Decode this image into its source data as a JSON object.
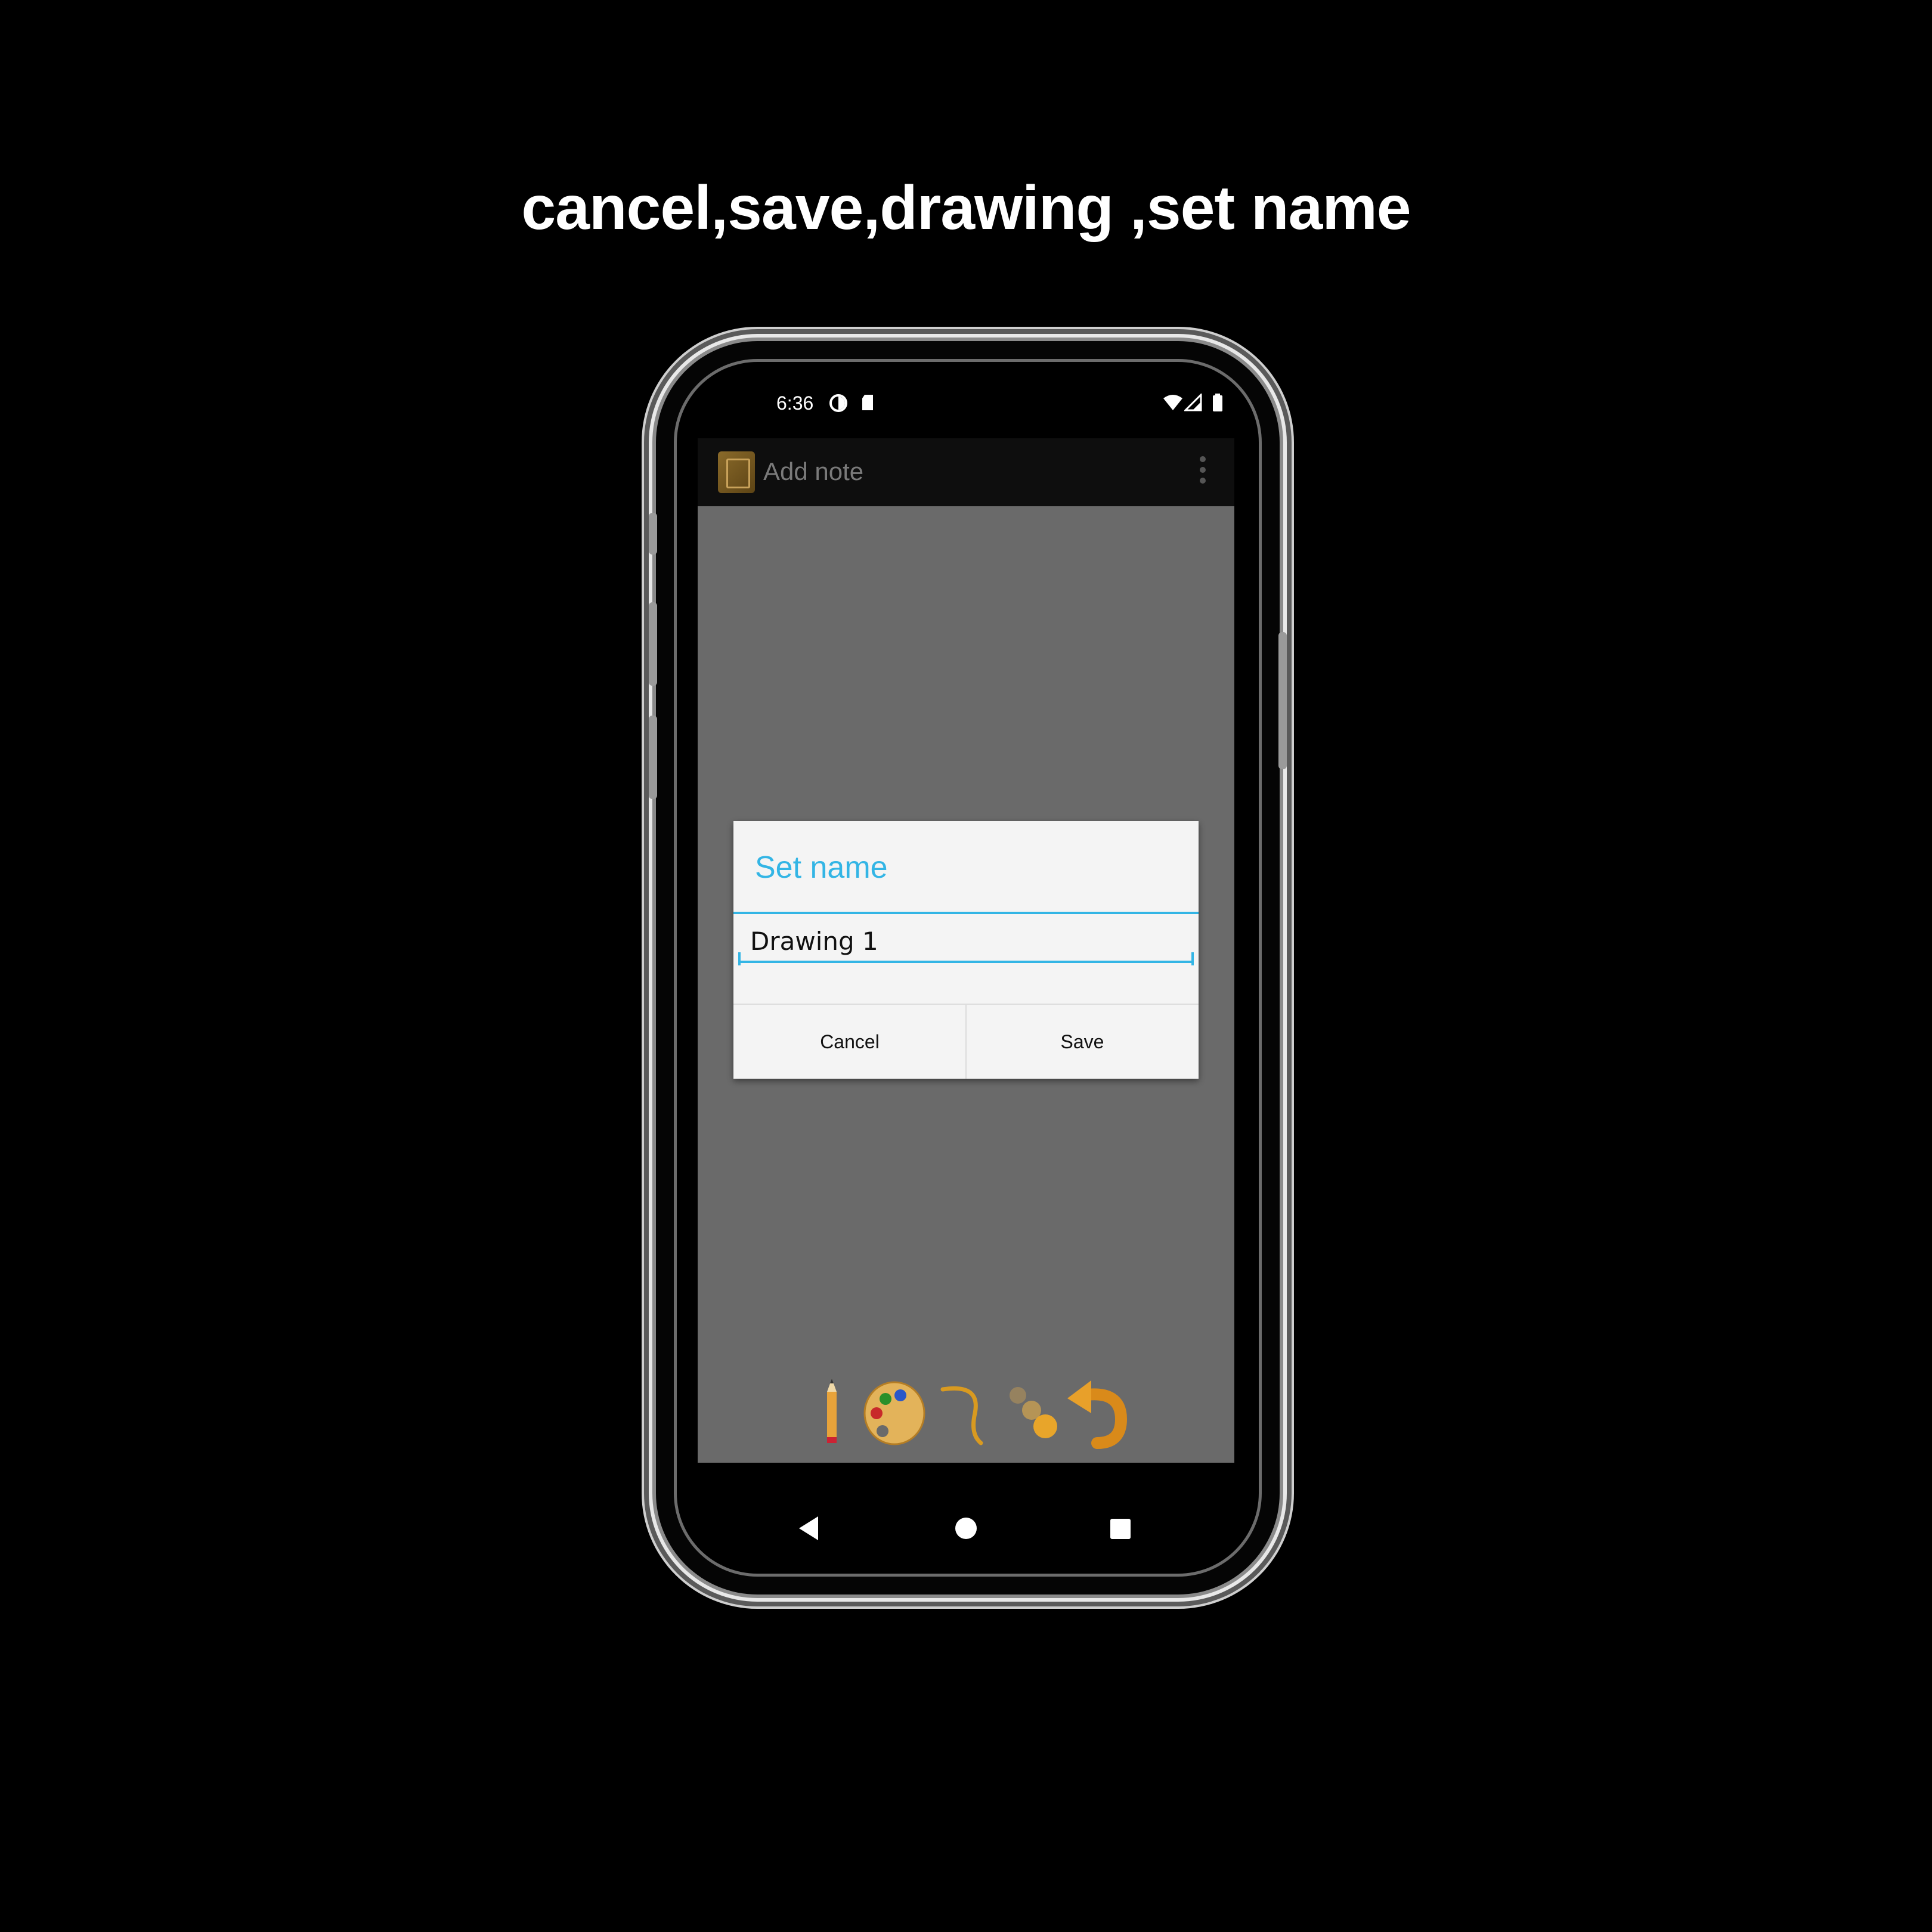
{
  "caption": "cancel,save,drawing ,set name",
  "status_bar": {
    "time": "6:36",
    "icons": [
      "data-saver-icon",
      "sd-card-icon",
      "wifi-icon",
      "signal-icon",
      "battery-icon"
    ]
  },
  "action_bar": {
    "title": "Add note",
    "icon": "notepad-app-icon",
    "overflow_icon": "overflow-menu-icon"
  },
  "dialog": {
    "title": "Set name",
    "input_value": "Drawing 1",
    "cancel_label": "Cancel",
    "save_label": "Save"
  },
  "drawing_tools": [
    "pencil-icon",
    "palette-icon",
    "brush-stroke-icon",
    "brush-size-icon",
    "undo-icon"
  ],
  "navigation": [
    "back-icon",
    "home-icon",
    "recents-icon"
  ],
  "colors": {
    "accent": "#33b5e5",
    "dim_background": "#6a6a6a",
    "dialog_background": "#f4f4f4"
  }
}
